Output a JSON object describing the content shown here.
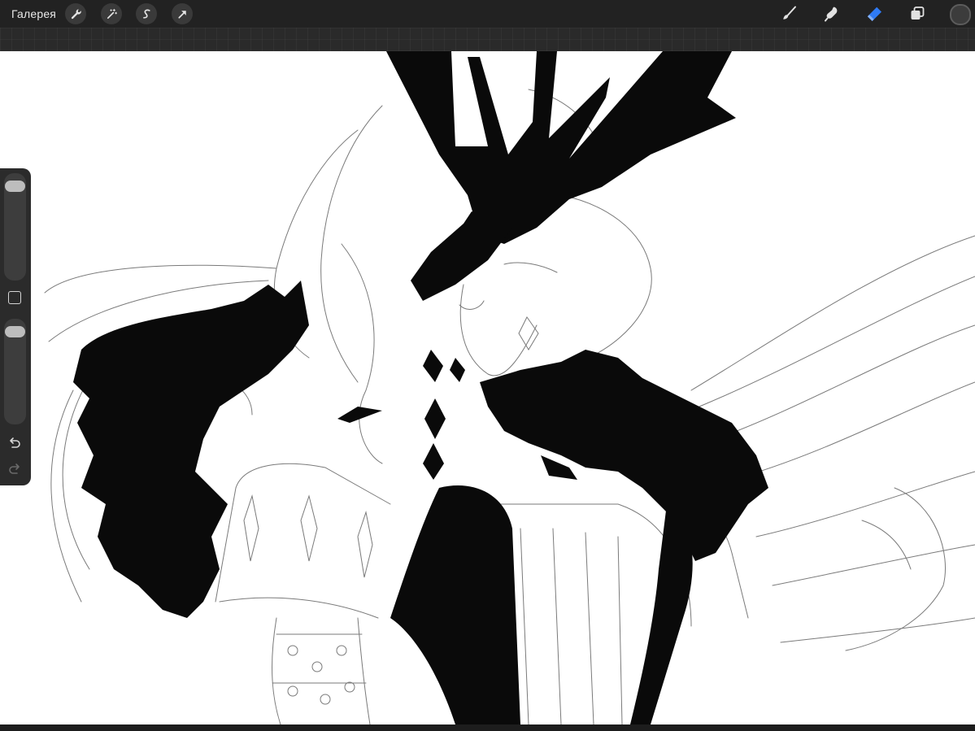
{
  "topbar": {
    "gallery_label": "Галерея",
    "left_tools": [
      {
        "icon": "wrench-icon"
      },
      {
        "icon": "magic-wand-icon"
      },
      {
        "icon": "selection-s-icon"
      },
      {
        "icon": "transform-arrow-icon"
      }
    ],
    "right_tools": [
      {
        "icon": "brush-icon",
        "active": false
      },
      {
        "icon": "smudge-icon",
        "active": false
      },
      {
        "icon": "eraser-icon",
        "active": true
      },
      {
        "icon": "layers-icon",
        "active": false
      }
    ],
    "current_color": "#3c3c3c"
  },
  "sidebar": {
    "brush_size_level": 0.95,
    "opacity_level": 0.95,
    "icons": [
      "modify-square-icon",
      "undo-icon",
      "redo-icon"
    ]
  },
  "colors": {
    "toolbar_bg": "#222222",
    "accent_eraser": "#2f7bf6",
    "ink": "#0a0a0a",
    "canvas": "#ffffff"
  }
}
